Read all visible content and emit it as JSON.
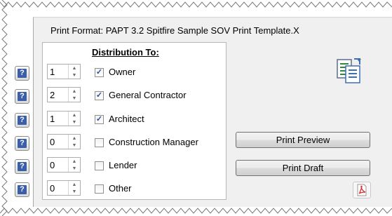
{
  "print_format": {
    "label": "Print Format: PAPT 3.2 Spitfire Sample SOV Print Template.X"
  },
  "distribution": {
    "title": "Distribution To:",
    "rows": [
      {
        "copies": "1",
        "checked": true,
        "label": "Owner"
      },
      {
        "copies": "2",
        "checked": true,
        "label": "General Contractor"
      },
      {
        "copies": "1",
        "checked": true,
        "label": "Architect"
      },
      {
        "copies": "0",
        "checked": false,
        "label": "Construction Manager"
      },
      {
        "copies": "0",
        "checked": false,
        "label": "Lender"
      },
      {
        "copies": "0",
        "checked": false,
        "label": "Other"
      }
    ]
  },
  "help": {
    "glyph": "?"
  },
  "actions": {
    "print_preview": "Print Preview",
    "print_draft": "Print Draft"
  },
  "icons": {
    "top_right": "export-document-icon",
    "pdf": "pdf-icon",
    "help": "help-icon"
  },
  "colors": {
    "panel": "#f0f0f0",
    "checkbox_tick": "#2b4f9c",
    "help_button": "#3a5fa8",
    "pdf_red": "#d92b2b"
  }
}
